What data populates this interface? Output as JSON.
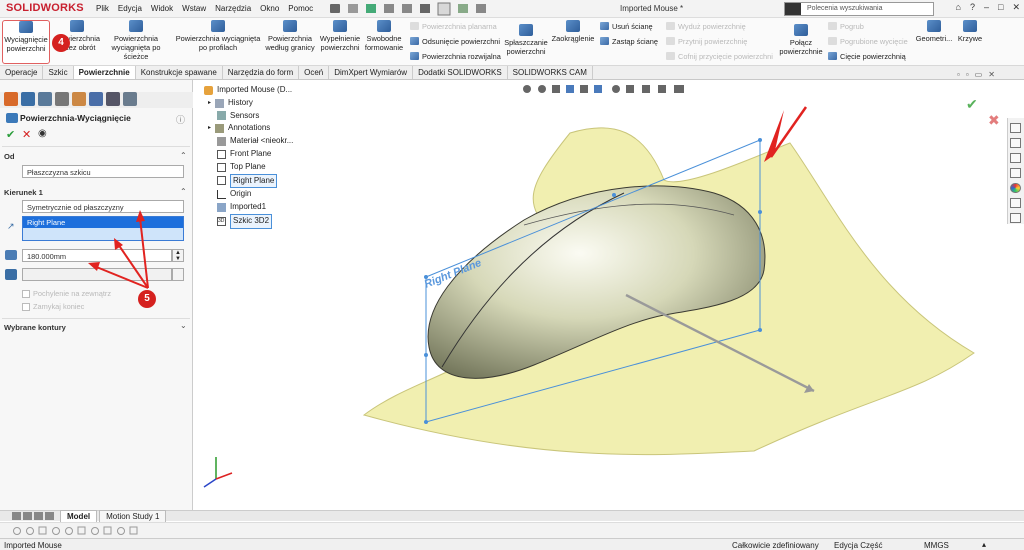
{
  "app": {
    "logo": "SOLIDWORKS",
    "doc_title": "Imported Mouse *"
  },
  "menu": [
    "Plik",
    "Edycja",
    "Widok",
    "Wstaw",
    "Narzędzia",
    "Okno",
    "Pomoc"
  ],
  "search": {
    "placeholder": "Polecenia wyszukiwania"
  },
  "ribbon": {
    "extrude_label_1": "Wyciągnięcie",
    "extrude_label_2": "powierzchni",
    "revolve_label_1": "Powierzchnia",
    "revolve_label_2": "przez obrót",
    "sweep_label_1": "Powierzchnia",
    "sweep_label_2": "wyciągnięta po ścieżce",
    "loft_label_1": "Powierzchnia wyciągnięta",
    "loft_label_2": "po profilach",
    "boundary_label_1": "Powierzchnia",
    "boundary_label_2": "według granicy",
    "fill_label_1": "Wypełnienie",
    "fill_label_2": "powierzchni",
    "freeform_label_1": "Swobodne",
    "freeform_label_2": "formowanie",
    "planar": "Powierzchnia planarna",
    "offset": "Odsunięcie powierzchni",
    "ruled": "Powierzchnia rozwijalna",
    "flatten_1": "Spłaszczanie",
    "flatten_2": "powierzchni",
    "fillet": "Zaokrąglenie",
    "delete_face": "Usuń ścianę",
    "replace_face": "Zastąp ścianę",
    "extend": "Wyduż powierzchnię",
    "trim": "Przytnij powierzchnię",
    "untrim": "Cofnij przycięcie powierzchni",
    "knit_1": "Połącz",
    "knit_2": "powierzchnie",
    "thicken": "Pogrub",
    "thicken_cut": "Pogrubione wycięcie",
    "surface_cut": "Cięcie powierzchnią",
    "geometry": "Geometri...",
    "curves": "Krzywe"
  },
  "tabs": [
    "Operacje",
    "Szkic",
    "Powierzchnie",
    "Konstrukcje spawane",
    "Narzędzia do form",
    "Oceń",
    "DimXpert Wymiarów",
    "Dodatki SOLIDWORKS",
    "SOLIDWORKS CAM"
  ],
  "property_manager": {
    "title": "Powierzchnia-Wyciągnięcie",
    "from_label": "Od",
    "from_value": "Płaszczyzna szkicu",
    "direction_label": "Kierunek 1",
    "end_condition": "Symetrycznie od płaszczyzny",
    "direction_ref": "Right Plane",
    "depth": "180.000mm",
    "draft_outward": "Pochylenie na zewnątrz",
    "cap_end": "Zamykaj koniec",
    "contours": "Wybrane kontury"
  },
  "tree": {
    "root": "Imported Mouse (D...",
    "items": [
      "History",
      "Sensors",
      "Annotations",
      "Materiał <nieokr...",
      "Front Plane",
      "Top Plane",
      "Right Plane",
      "Origin",
      "Imported1",
      "Szkic 3D2"
    ]
  },
  "viewport": {
    "plane_label": "Right Plane"
  },
  "callouts": {
    "a": "4",
    "b": "5"
  },
  "bottom_tabs": [
    "Model",
    "Motion Study 1"
  ],
  "status": {
    "left": "Imported Mouse",
    "defined": "Całkowicie zdefiniowany",
    "editing": "Edycja Część",
    "units": "MMGS"
  },
  "colors": {
    "surface": "#f1efb0",
    "selection": "#4a90d9",
    "callout": "#d5211f"
  }
}
